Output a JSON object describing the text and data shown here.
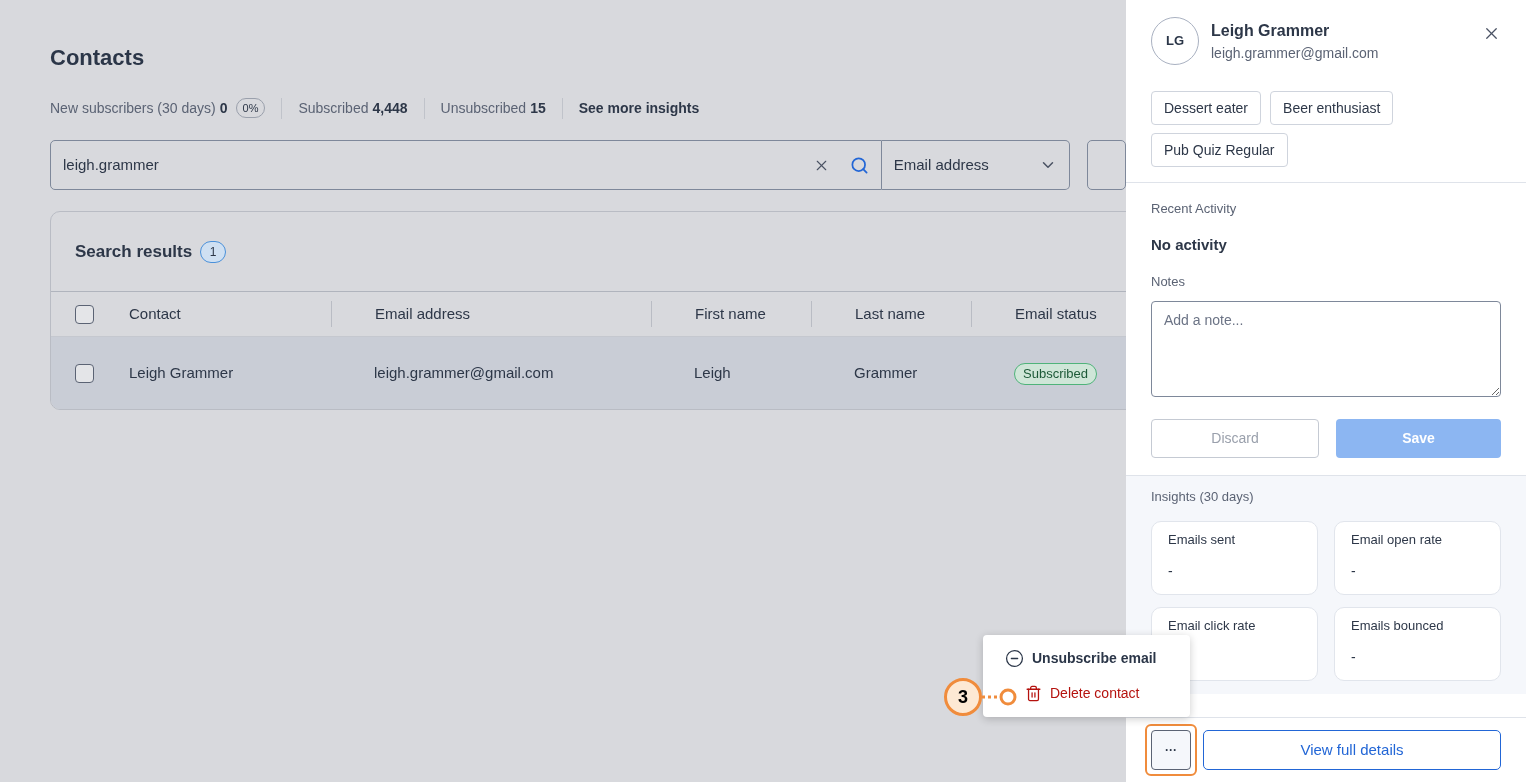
{
  "page": {
    "title": "Contacts"
  },
  "stats": [
    {
      "label": "New subscribers (30 days)",
      "value": "0",
      "badge": "0%"
    },
    {
      "label": "Subscribed",
      "value": "4,448"
    },
    {
      "label": "Unsubscribed",
      "value": "15"
    }
  ],
  "insights_link": "See more insights",
  "search": {
    "value": "leigh.grammer",
    "field": "Email address"
  },
  "results": {
    "title": "Search results",
    "count": "1",
    "all_checked": false,
    "columns": [
      "Contact",
      "Email address",
      "First name",
      "Last name",
      "Email status"
    ],
    "rows": [
      {
        "checked": false,
        "highlighted": true,
        "cells": [
          "Leigh Grammer",
          "leigh.grammer@gmail.com",
          "Leigh",
          "Grammer"
        ],
        "status": "Subscribed"
      }
    ]
  },
  "panel": {
    "initials": "LG",
    "name": "Leigh Grammer",
    "email": "leigh.grammer@gmail.com",
    "tags": [
      "Dessert eater",
      "Beer enthusiast",
      "Pub Quiz Regular"
    ],
    "activity_label": "Recent Activity",
    "activity": "No activity",
    "notes_label": "Notes",
    "notes_placeholder": "Add a note...",
    "discard": "Discard",
    "save": "Save",
    "save_disabled": true,
    "insights_label": "Insights (30 days)",
    "insights": [
      {
        "label": "Emails sent",
        "value": "-"
      },
      {
        "label": "Email open rate",
        "value": "-"
      },
      {
        "label": "Email click rate"
      },
      {
        "label": "Emails bounced",
        "value": "-"
      }
    ],
    "more": "···",
    "view": "View full details"
  },
  "menu": {
    "items": [
      {
        "kind": "unsubscribe",
        "label": "Unsubscribe email"
      },
      {
        "kind": "delete",
        "label": "Delete contact"
      }
    ]
  },
  "callout": {
    "number": "3"
  }
}
